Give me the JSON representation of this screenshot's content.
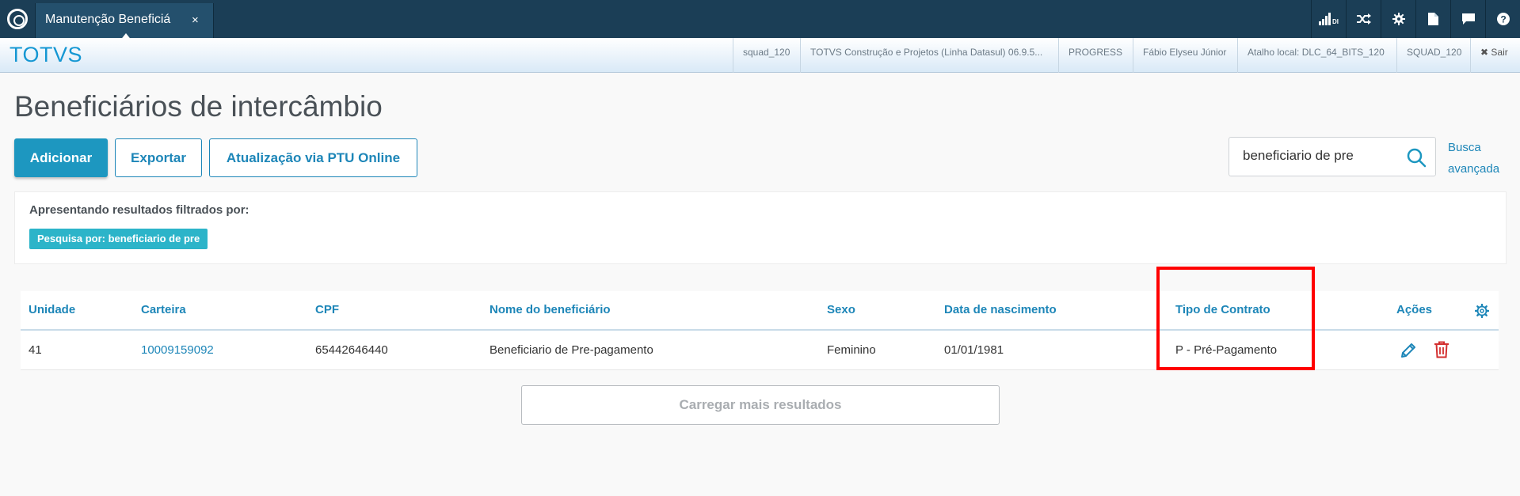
{
  "topbar": {
    "tab_title": "Manutenção Beneficiá",
    "tab_close": "×",
    "icons": [
      "signal-bars-icon",
      "shuffle-icon",
      "gear-icon",
      "document-icon",
      "chat-icon",
      "help-icon"
    ]
  },
  "subbar": {
    "brand": "TOTVS",
    "items": [
      "squad_120",
      "TOTVS Construção e Projetos (Linha Datasul) 06.9.5...",
      "PROGRESS",
      "Fábio Elyseu Júnior",
      "Atalho local: DLC_64_BITS_120",
      "SQUAD_120"
    ],
    "exit_label": "✖ Sair"
  },
  "page": {
    "title": "Beneficiários de intercâmbio",
    "buttons": {
      "add": "Adicionar",
      "export": "Exportar",
      "ptu_update": "Atualização via PTU Online"
    },
    "search": {
      "value": "beneficiario de pre"
    },
    "advanced_search": "Busca avançada"
  },
  "filters": {
    "label": "Apresentando resultados filtrados por:",
    "tag": "Pesquisa por: beneficiario de pre"
  },
  "table": {
    "headers": [
      "Unidade",
      "Carteira",
      "CPF",
      "Nome do beneficiário",
      "Sexo",
      "Data de nascimento",
      "Tipo de Contrato",
      "Ações"
    ],
    "rows": [
      [
        "41",
        "10009159092",
        "65442646440",
        "Beneficiario de Pre-pagamento",
        "Feminino",
        "01/01/1981",
        "P - Pré-Pagamento"
      ]
    ]
  },
  "load_more": "Carregar mais resultados",
  "colors": {
    "topbar": "#1b3e56",
    "accent": "#1d97c0",
    "highlight": "#ff0000",
    "delete": "#d32f2f"
  }
}
